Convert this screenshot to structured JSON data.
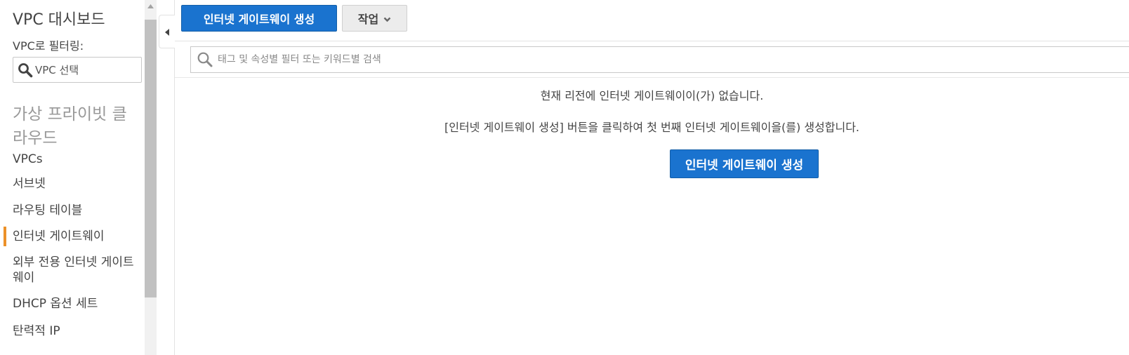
{
  "sidebar": {
    "title": "VPC 대시보드",
    "filter_label": "VPC로 필터링:",
    "vpc_select": {
      "placeholder": "VPC 선택",
      "icon": "search-icon"
    },
    "section_title": "가상 프라이빗 클라우드",
    "items": [
      {
        "label": "VPCs",
        "active": false
      },
      {
        "label": "서브넷",
        "active": false
      },
      {
        "label": "라우팅 테이블",
        "active": false
      },
      {
        "label": "인터넷 게이트웨이",
        "active": true
      },
      {
        "label": "외부 전용 인터넷 게이트웨이",
        "active": false
      },
      {
        "label": "DHCP 옵션 세트",
        "active": false
      },
      {
        "label": "탄력적 IP",
        "active": false
      }
    ]
  },
  "toolbar": {
    "create_button": "인터넷 게이트웨이 생성",
    "actions_button": "작업",
    "actions_icon": "chevron-down-icon"
  },
  "search": {
    "placeholder": "태그 및 속성별 필터 또는 키워드별 검색",
    "value": "",
    "icon": "search-icon"
  },
  "empty_state": {
    "message": "현재 리전에 인터넷 게이트웨이이(가) 없습니다.",
    "hint": "[인터넷 게이트웨이 생성] 버튼을 클릭하여 첫 번째 인터넷 게이트웨이을(를) 생성합니다.",
    "create_button": "인터넷 게이트웨이 생성"
  },
  "colors": {
    "primary_button": "#1a73cf",
    "active_indicator": "#ec9129",
    "section_title": "#999999"
  }
}
